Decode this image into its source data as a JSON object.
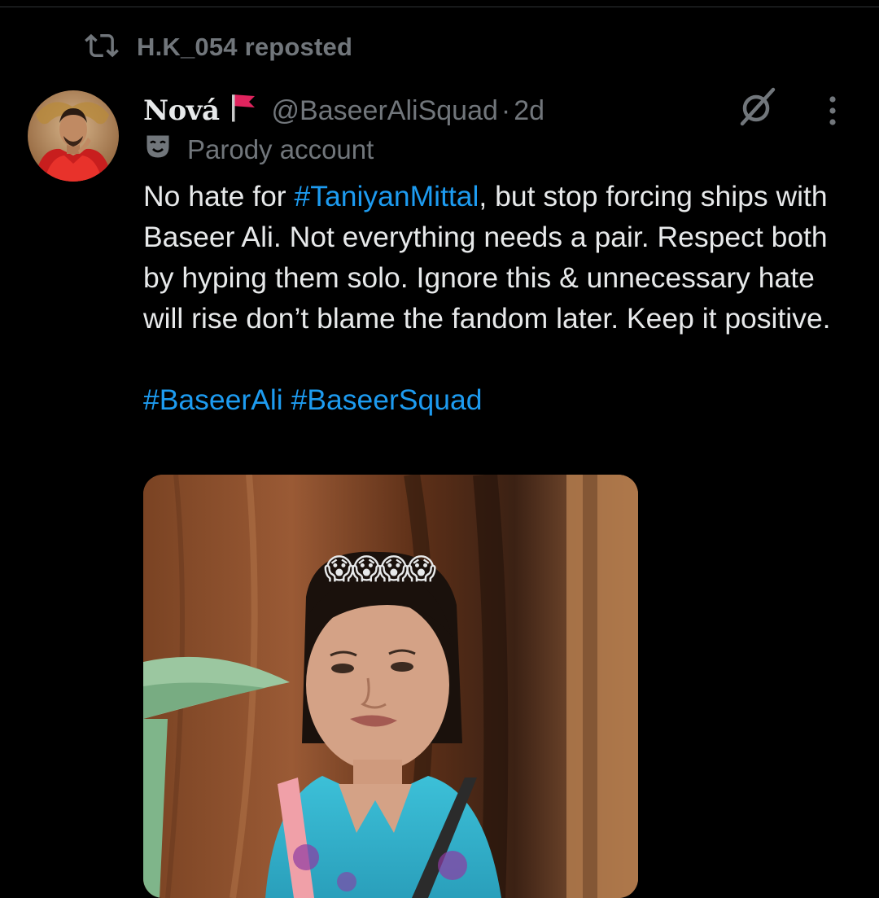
{
  "repost": {
    "icon": "repost-icon",
    "label": "H.K_054 reposted"
  },
  "tweet": {
    "author": {
      "display_name": "Nová",
      "flag_emoji": "red-flag-icon",
      "handle": "@BaseerAliSquad",
      "separator": "·",
      "time": "2d",
      "avatar": "avatar-image"
    },
    "label": {
      "icon": "parody-mask-icon",
      "text": "Parody account"
    },
    "text_before_tag": "No hate for ",
    "inline_hashtag": "#TaniyanMittal",
    "text_after_tag": ", but stop forcing ships with Baseer Ali. Not everything needs a pair. Respect both by hyping them solo. Ignore this & unnecessary hate will rise don’t blame the fandom later. Keep it positive.",
    "hashtags": [
      "#BaseerAli",
      "#BaseerSquad"
    ],
    "media": {
      "caption": "😱😱😱😱"
    },
    "actions": {
      "grok": "grok-icon",
      "more": "more-icon"
    }
  },
  "colors": {
    "background": "#000000",
    "text": "#e7e9ea",
    "muted": "#71767b",
    "link": "#1d9bf0"
  }
}
